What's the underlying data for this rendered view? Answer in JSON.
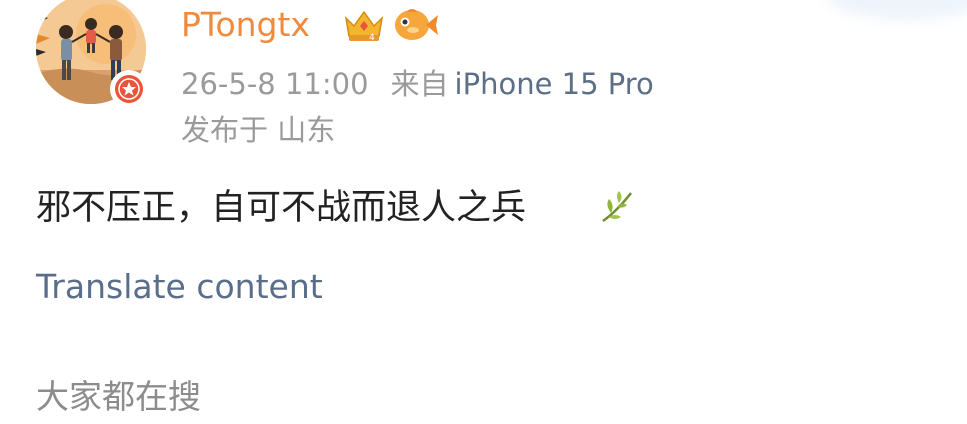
{
  "post": {
    "username": "PTongtx",
    "timestamp": "26-5-8 11:00",
    "source_prefix": "来自",
    "device": "iPhone 15 Pro",
    "location": "发布于 山东",
    "text": "邪不压正，自可不战而退人之兵",
    "translate_label": "Translate content"
  },
  "section": {
    "title": "大家都在搜"
  },
  "colors": {
    "username": "#f08a3c",
    "meta": "#9a9a9a",
    "link": "#5a6e8a",
    "badge": "#e8553b"
  },
  "icons": {
    "avatar": "cartoon-family-avatar",
    "verified_badge": "star-badge-icon",
    "crown": "crown-vip-icon",
    "fish": "fish-icon",
    "leaf": "leaf-emoji"
  }
}
